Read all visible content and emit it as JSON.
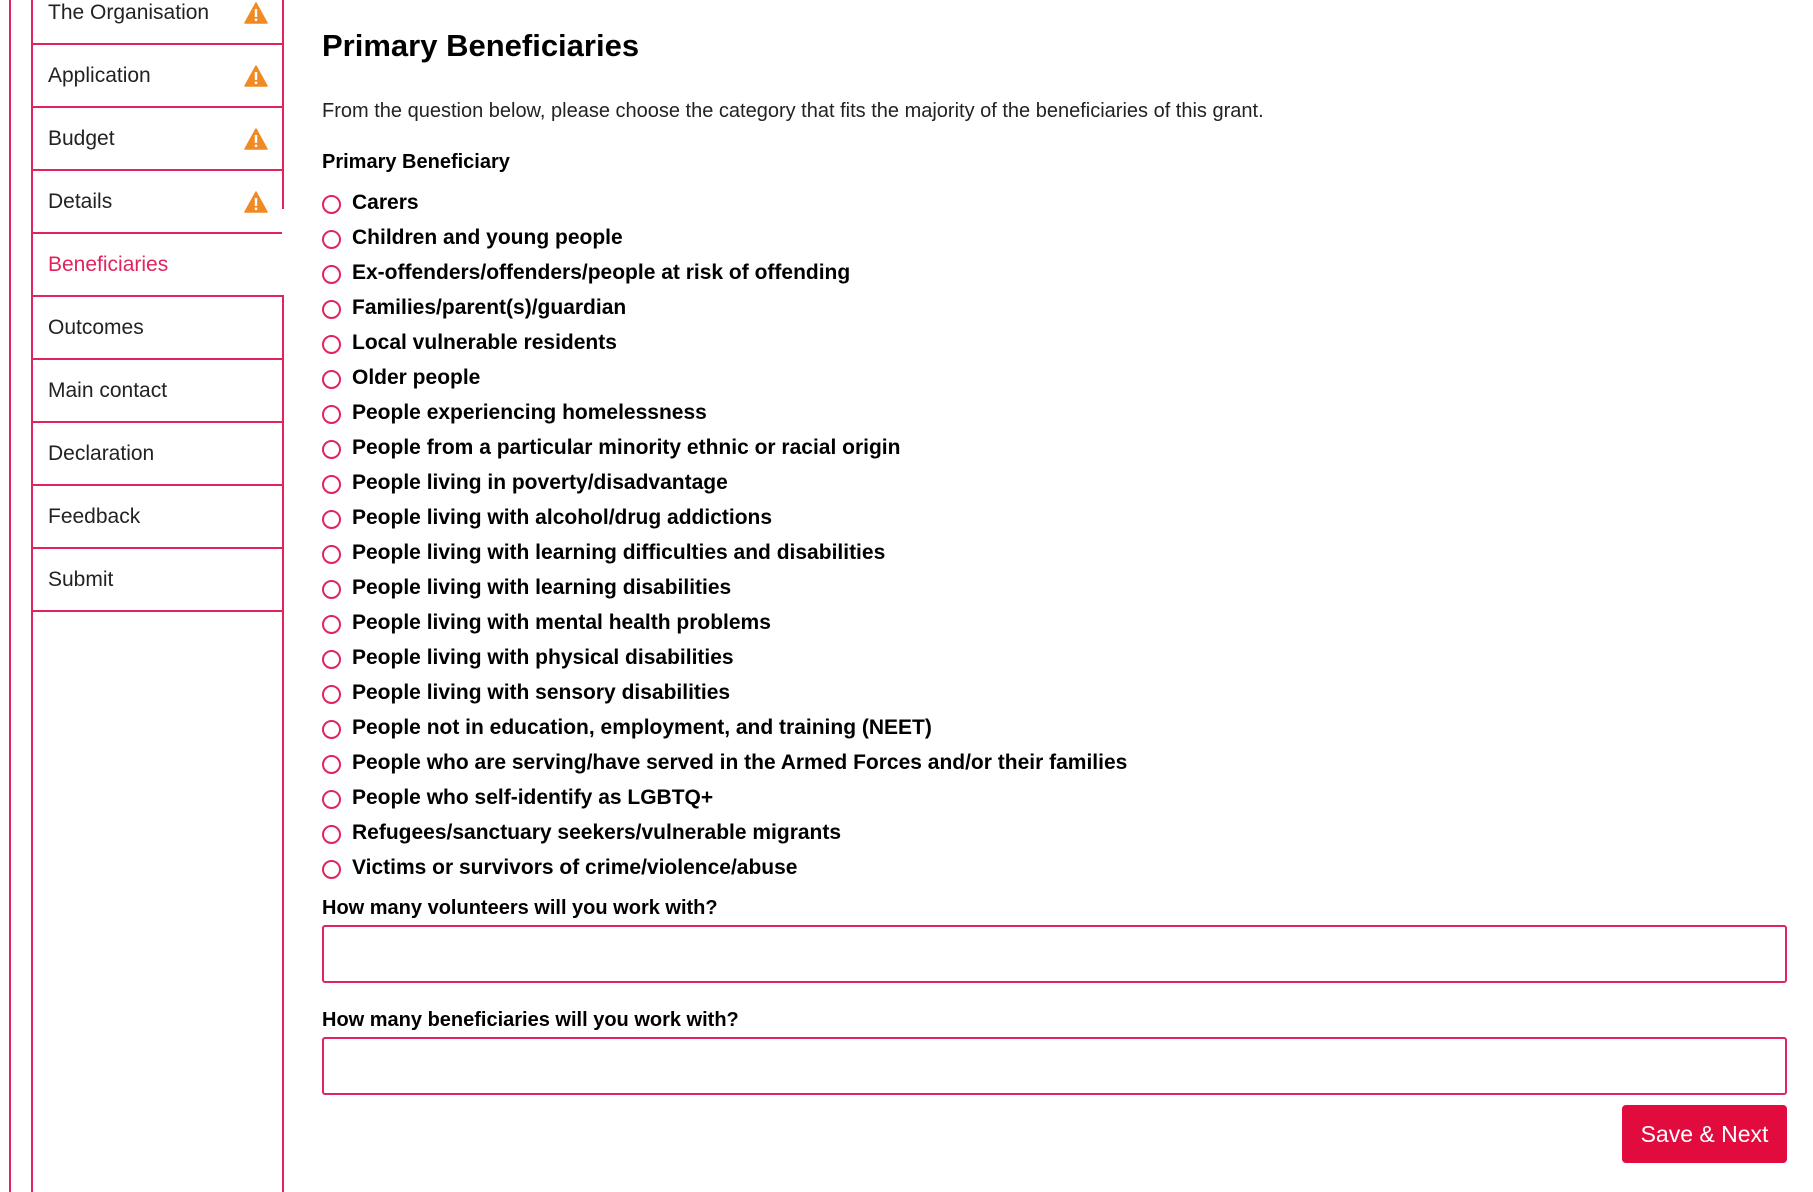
{
  "sidebar": {
    "items": [
      {
        "label": "The Organisation",
        "warning": true,
        "active": false
      },
      {
        "label": "Application",
        "warning": true,
        "active": false
      },
      {
        "label": "Budget",
        "warning": true,
        "active": false
      },
      {
        "label": "Details",
        "warning": true,
        "active": false
      },
      {
        "label": "Beneficiaries",
        "warning": false,
        "active": true
      },
      {
        "label": "Outcomes",
        "warning": false,
        "active": false
      },
      {
        "label": "Main contact",
        "warning": false,
        "active": false
      },
      {
        "label": "Declaration",
        "warning": false,
        "active": false
      },
      {
        "label": "Feedback",
        "warning": false,
        "active": false
      },
      {
        "label": "Submit",
        "warning": false,
        "active": false
      }
    ],
    "warning_icon": "warning-triangle-icon",
    "warning_color": "#f08a24",
    "accent_color": "#e0245e"
  },
  "main": {
    "title": "Primary Beneficiaries",
    "intro": "From the question below, please choose the category that fits the majority of the beneficiaries of this grant.",
    "question_label": "Primary Beneficiary",
    "options": [
      "Carers",
      "Children and young people",
      "Ex-offenders/offenders/people at risk of offending",
      "Families/parent(s)/guardian",
      "Local vulnerable residents",
      "Older people",
      "People experiencing homelessness",
      "People from a particular minority ethnic or racial origin",
      "People living in poverty/disadvantage",
      "People living with alcohol/drug addictions",
      "People living with learning difficulties and disabilities",
      "People living with learning disabilities",
      "People living with mental health problems",
      "People living with physical disabilities",
      "People living with sensory disabilities",
      "People not in education, employment, and training (NEET)",
      "People who are serving/have served in the Armed Forces and/or their families",
      "People who self-identify as LGBTQ+",
      "Refugees/sanctuary seekers/vulnerable migrants",
      "Victims or survivors of crime/violence/abuse"
    ],
    "volunteers_label": "How many volunteers will you work with?",
    "volunteers_value": "",
    "beneficiaries_label": "How many beneficiaries will you work with?",
    "beneficiaries_value": "",
    "save_button_label": "Save & Next",
    "button_color": "#e10b3e"
  }
}
